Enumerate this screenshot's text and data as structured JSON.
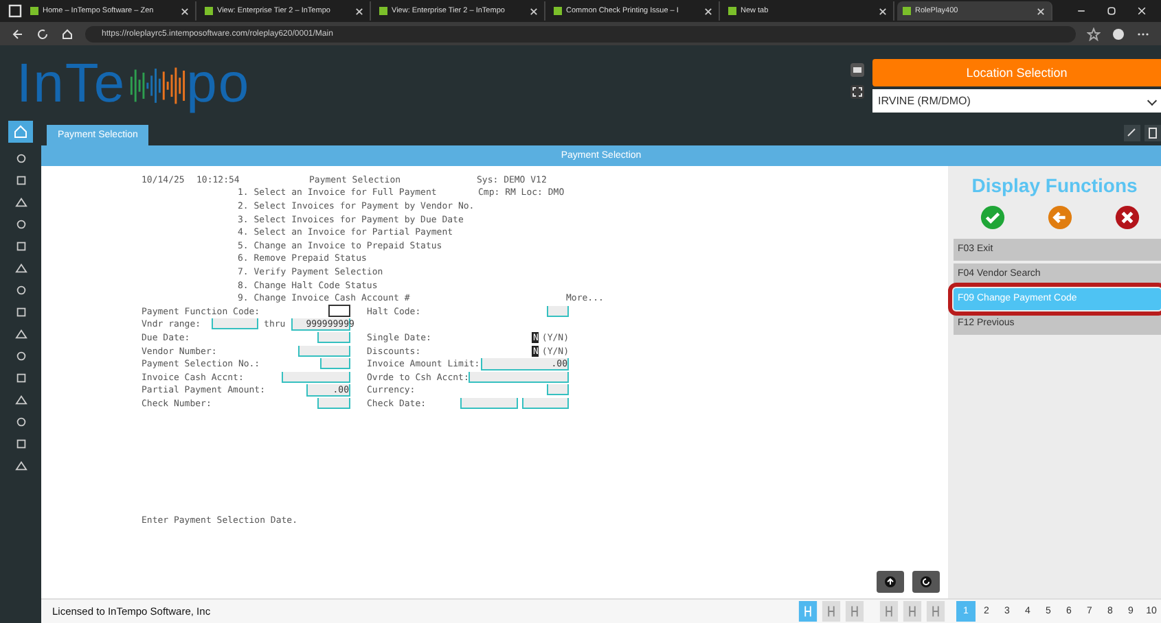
{
  "browser": {
    "tabs": [
      {
        "title": "Home – InTempo Software – Zen",
        "selected": false
      },
      {
        "title": "View: Enterprise Tier 2 – InTempo",
        "selected": false
      },
      {
        "title": "View: Enterprise Tier 2 – InTempo",
        "selected": false
      },
      {
        "title": "Common Check Printing Issue – I",
        "selected": false
      },
      {
        "title": "New tab",
        "selected": false
      },
      {
        "title": "RolePlay400",
        "selected": true
      }
    ],
    "url": "https://roleplayrc5.intemposoftware.com/roleplay620/0001/Main"
  },
  "app": {
    "logo": {
      "left": "InTe",
      "right": "po"
    },
    "location_button": "Location Selection",
    "location_select": "IRVINE (RM/DMO)",
    "tabs": [
      {
        "label": "Payment Selection",
        "selected": true
      }
    ],
    "panel_title": "Payment Selection"
  },
  "terminal": {
    "date": "10/14/25",
    "time": "10:12:54",
    "title": "Payment Selection",
    "sys": "Sys: DEMO V12",
    "cmp": "Cmp: RM Loc: DMO",
    "menu": [
      "1. Select an Invoice for Full Payment",
      "2. Select Invoices for Payment by Vendor No.",
      "3. Select Invoices for Payment by Due Date",
      "4. Select an Invoice for Partial Payment",
      "5. Change an Invoice to Prepaid Status",
      "6. Remove Prepaid Status",
      "7. Verify Payment Selection",
      "8. Change Halt Code Status",
      "9. Change Invoice Cash Account #"
    ],
    "more": "More...",
    "rows": [
      {
        "left": {
          "label": "Payment Function Code:"
        },
        "right": {
          "label": "Halt Code:"
        }
      },
      {
        "left": {
          "label": "Vndr range:",
          "joiner": "thru",
          "value": "999999999"
        }
      },
      {
        "left": {
          "label": "Due Date:"
        },
        "right": {
          "label": "Single Date:",
          "value": "N",
          "suffix": "(Y/N)"
        }
      },
      {
        "left": {
          "label": "Vendor Number:"
        },
        "right": {
          "label": "Discounts:",
          "value": "N",
          "suffix": "(Y/N)"
        }
      },
      {
        "left": {
          "label": "Payment Selection No.:"
        },
        "right": {
          "label": "Invoice Amount Limit:",
          "value": ".00"
        }
      },
      {
        "left": {
          "label": "Invoice Cash Accnt:"
        },
        "right": {
          "label": "Ovrde to Csh Accnt:"
        }
      },
      {
        "left": {
          "label": "Partial Payment Amount:",
          "value": ".00"
        },
        "right": {
          "label": "Currency:"
        }
      },
      {
        "left": {
          "label": "Check Number:"
        },
        "right": {
          "label": "Check Date:"
        }
      }
    ],
    "message": "Enter Payment Selection Date."
  },
  "functions": {
    "title": "Display Functions",
    "keys": [
      {
        "label": "F03 Exit",
        "selected": false
      },
      {
        "label": "F04 Vendor Search",
        "selected": false
      },
      {
        "label": "F09 Change Payment Code",
        "selected": true
      },
      {
        "label": "F12 Previous",
        "selected": false
      }
    ]
  },
  "status_bar": {
    "license": "Licensed to InTempo Software, Inc",
    "tools": [
      {
        "selected": true
      },
      {
        "selected": false
      },
      {
        "selected": false
      },
      {
        "selected": false
      },
      {
        "selected": false
      },
      {
        "selected": false
      }
    ],
    "pages": [
      {
        "label": "1",
        "selected": true
      },
      {
        "label": "2",
        "selected": false
      },
      {
        "label": "3",
        "selected": false
      },
      {
        "label": "4",
        "selected": false
      },
      {
        "label": "5",
        "selected": false
      },
      {
        "label": "6",
        "selected": false
      },
      {
        "label": "7",
        "selected": false
      },
      {
        "label": "8",
        "selected": false
      },
      {
        "label": "9",
        "selected": false
      },
      {
        "label": "10",
        "selected": false
      }
    ]
  }
}
